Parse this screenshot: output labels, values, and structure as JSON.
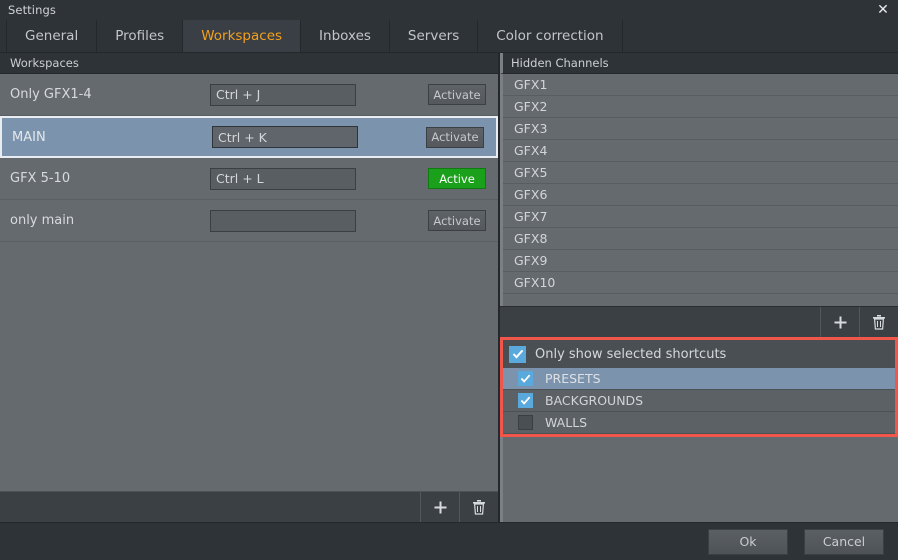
{
  "window": {
    "title": "Settings",
    "close_icon": "close-icon"
  },
  "tabs": [
    {
      "label": "General",
      "active": false
    },
    {
      "label": "Profiles",
      "active": false
    },
    {
      "label": "Workspaces",
      "active": true
    },
    {
      "label": "Inboxes",
      "active": false
    },
    {
      "label": "Servers",
      "active": false
    },
    {
      "label": "Color correction",
      "active": false
    }
  ],
  "left": {
    "header": "Workspaces",
    "rows": [
      {
        "name": "Only GFX1-4",
        "shortcut": "Ctrl + J",
        "placeholder": "",
        "button": "Activate",
        "active": false,
        "selected": false
      },
      {
        "name": "MAIN",
        "shortcut": "Ctrl + K",
        "placeholder": "",
        "button": "Activate",
        "active": false,
        "selected": true
      },
      {
        "name": "GFX 5-10",
        "shortcut": "Ctrl + L",
        "placeholder": "",
        "button": "Active",
        "active": true,
        "selected": false
      },
      {
        "name": "only main",
        "shortcut": "",
        "placeholder": "",
        "button": "Activate",
        "active": false,
        "selected": false
      }
    ],
    "toolbar": {
      "add_icon": "plus-icon",
      "delete_icon": "trash-icon"
    }
  },
  "right": {
    "header": "Hidden Channels",
    "channels": [
      "GFX1",
      "GFX2",
      "GFX3",
      "GFX4",
      "GFX5",
      "GFX6",
      "GFX7",
      "GFX8",
      "GFX9",
      "GFX10"
    ],
    "toolbar": {
      "add_icon": "plus-icon",
      "delete_icon": "trash-icon"
    },
    "shortcuts": {
      "only_show_label": "Only show selected shortcuts",
      "only_show_checked": true,
      "items": [
        {
          "label": "PRESETS",
          "checked": true,
          "selected": true
        },
        {
          "label": "BACKGROUNDS",
          "checked": true,
          "selected": false
        },
        {
          "label": "WALLS",
          "checked": false,
          "selected": false
        }
      ]
    }
  },
  "footer": {
    "ok": "Ok",
    "cancel": "Cancel"
  },
  "colors": {
    "accent_orange": "#f2a01e",
    "active_green": "#1ba01b",
    "highlight_red": "#f1564b",
    "checkbox_blue": "#5aa9dd",
    "selection_blue": "#7c93ad"
  }
}
